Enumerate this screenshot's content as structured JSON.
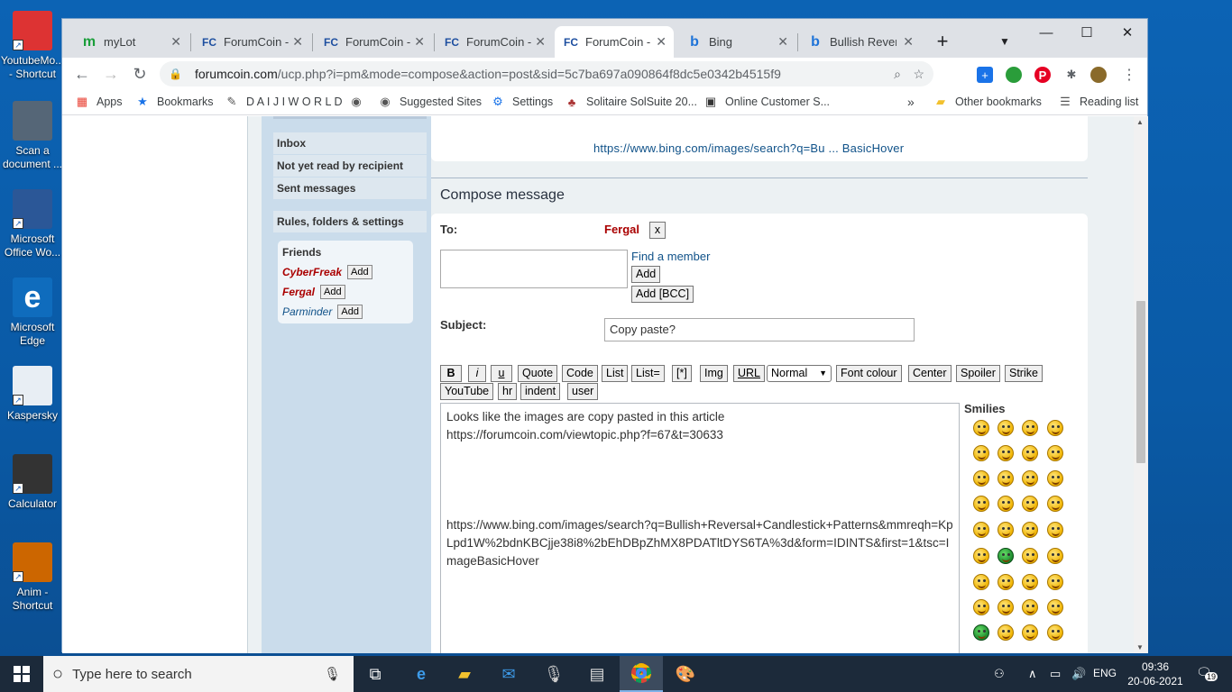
{
  "desktop": {
    "icons": [
      {
        "label": "YoutubeMo... - Shortcut",
        "color": "#d33"
      },
      {
        "label": "Scan a document ...",
        "color": "#456"
      },
      {
        "label": "Microsoft Office Wo...",
        "color": "#2b5797"
      },
      {
        "label": "Microsoft Edge",
        "color": "#0f6cbd"
      },
      {
        "label": "Kaspersky",
        "color": "#e8eef4"
      },
      {
        "label": "Calculator",
        "color": "#333"
      },
      {
        "label": "Anim - Shortcut",
        "color": "#c60"
      }
    ]
  },
  "tabs": [
    {
      "label": "myLot",
      "icon": "m"
    },
    {
      "label": "ForumCoin -",
      "icon": "FC"
    },
    {
      "label": "ForumCoin -",
      "icon": "FC"
    },
    {
      "label": "ForumCoin -",
      "icon": "FC"
    },
    {
      "label": "ForumCoin -",
      "icon": "FC"
    },
    {
      "label": "Bing",
      "icon": "b"
    },
    {
      "label": "Bullish Rever",
      "icon": "b"
    }
  ],
  "address": {
    "domain": "forumcoin.com",
    "path": "/ucp.php?i=pm&mode=compose&action=post&sid=5c7ba697a090864f8dc5e0342b4515f9"
  },
  "bookmarks": {
    "items": [
      "Apps",
      "Bookmarks",
      "D A I J I W O R L D",
      "",
      "Suggested Sites",
      "Settings",
      "Solitaire SolSuite 20...",
      "Online Customer S..."
    ],
    "other": "Other bookmarks",
    "reading": "Reading list",
    "more": "»"
  },
  "sidebar": {
    "nav": [
      "Inbox",
      "Not yet read by recipient",
      "Sent messages"
    ],
    "rules": "Rules, folders & settings",
    "friends_title": "Friends",
    "friends": [
      {
        "name": "CyberFreak",
        "color": "#aa0000",
        "bold": true
      },
      {
        "name": "Fergal",
        "color": "#aa0000",
        "bold": true
      },
      {
        "name": "Parminder",
        "color": "#105289",
        "bold": false
      }
    ],
    "add_label": "Add"
  },
  "preview": {
    "link": "https://www.bing.com/images/search?q=Bu ... BasicHover"
  },
  "compose": {
    "title": "Compose message",
    "to_label": "To:",
    "recipient": "Fergal",
    "remove": "x",
    "find_member": "Find a member",
    "add": "Add",
    "add_bcc": "Add [BCC]",
    "subject_label": "Subject:",
    "subject_value": "Copy paste?",
    "toolbar_row1": [
      "B",
      "i",
      "u",
      "Quote",
      "Code",
      "List",
      "List=",
      "[*]",
      "Img",
      "URL",
      "Normal",
      "Font colour",
      "Center",
      "Spoiler",
      "Strike"
    ],
    "toolbar_row2": [
      "YouTube",
      "hr",
      "indent",
      "user"
    ],
    "message": "Looks like the images are copy pasted in this article\nhttps://forumcoin.com/viewtopic.php?f=67&t=30633\n\n\n\n\nhttps://www.bing.com/images/search?q=Bullish+Reversal+Candlestick+Patterns&mmreqh=KpLpd1W%2bdnKBCjje38i8%2bEhDBpZhMX8PDATltDYS6TA%3d&form=IDINTS&first=1&tsc=ImageBasicHover",
    "smilies_title": "Smilies"
  },
  "taskbar": {
    "search_placeholder": "Type here to search",
    "lang": "ENG",
    "time": "09:36",
    "date": "20-06-2021",
    "notif_count": "19"
  }
}
